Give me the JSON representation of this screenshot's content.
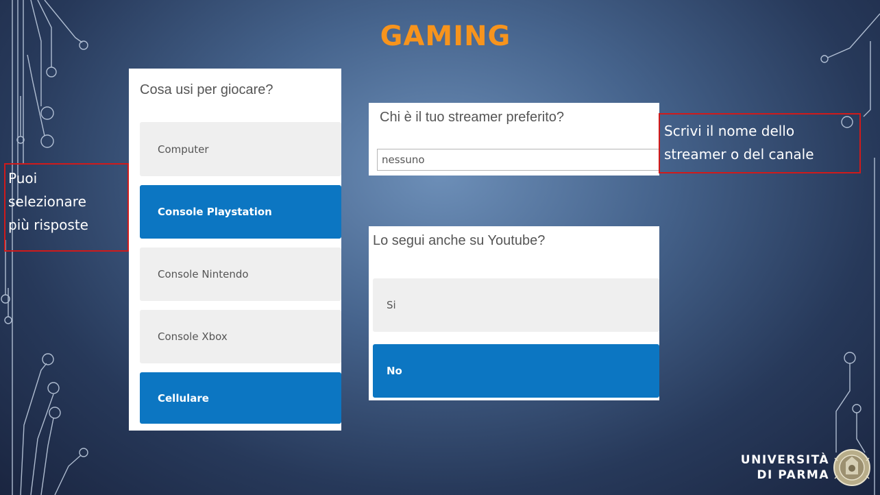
{
  "slide": {
    "title": "GAMING"
  },
  "question1": {
    "label": "Cosa usi per giocare?",
    "options": [
      {
        "label": "Computer",
        "selected": false
      },
      {
        "label": "Console Playstation",
        "selected": true
      },
      {
        "label": "Console Nintendo",
        "selected": false
      },
      {
        "label": "Console Xbox",
        "selected": false
      },
      {
        "label": "Cellulare",
        "selected": true
      }
    ]
  },
  "question2": {
    "label": "Chi è il tuo streamer preferito?",
    "value": "nessuno"
  },
  "question3": {
    "label": "Lo segui anche su Youtube?",
    "options": [
      {
        "label": "Si",
        "selected": false
      },
      {
        "label": "No",
        "selected": true
      }
    ]
  },
  "callouts": {
    "left_lines": [
      "Puoi",
      "selezionare",
      "più risposte"
    ],
    "right_lines": [
      "Scrivi il nome dello",
      "streamer o del canale"
    ]
  },
  "logo": {
    "line1": "UNIVERSITÀ",
    "line2": "DI PARMA",
    "seal_icon": "university-seal-icon"
  },
  "colors": {
    "title": "#f7941d",
    "selected": "#0c76c2",
    "unselected": "#efefef",
    "callout_border": "#d11a1a"
  }
}
